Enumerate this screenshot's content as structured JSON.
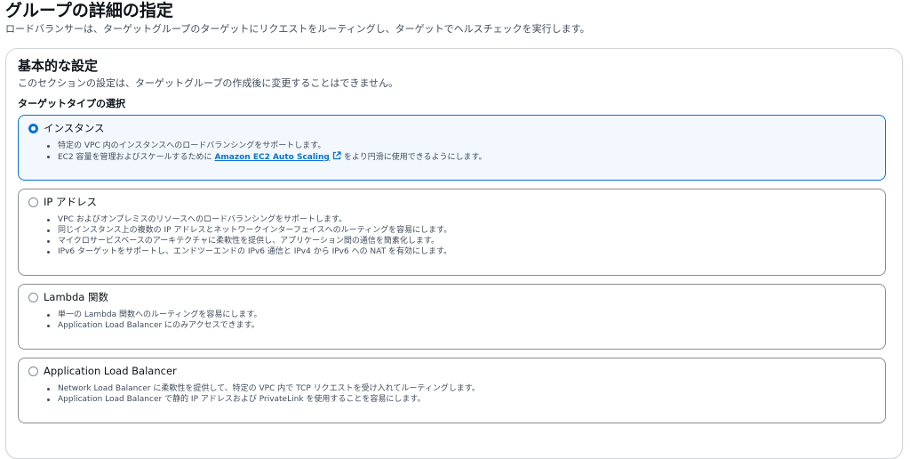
{
  "header": {
    "title": "グループの詳細の指定",
    "description": "ロードバランサーは、ターゲットグループのターゲットにリクエストをルーティングし、ターゲットでヘルスチェックを実行します。"
  },
  "basic_settings": {
    "title": "基本的な設定",
    "description": "このセクションの設定は、ターゲットグループの作成後に変更することはできません。",
    "target_type_label": "ターゲットタイプの選択",
    "selected": "instances",
    "options": {
      "instances": {
        "label": "インスタンス",
        "bullet_1": "特定の VPC 内のインスタンスへのロードバランシングをサポートします。",
        "bullet_2_prefix": "EC2 容量を管理およびスケールするために",
        "bullet_2_link": "Amazon EC2 Auto Scaling",
        "bullet_2_link_icon": "external-link-icon",
        "bullet_2_suffix": "をより円滑に使用できるようにします。"
      },
      "ip": {
        "label": "IP アドレス",
        "bullets": [
          "VPC およびオンプレミスのリソースへのロードバランシングをサポートします。",
          "同じインスタンス上の複数の IP アドレスとネットワークインターフェイスへのルーティングを容易にします。",
          "マイクロサービスベースのアーキテクチャに柔軟性を提供し、アプリケーション間の通信を簡素化します。",
          "IPv6 ターゲットをサポートし、エンドツーエンドの IPv6 通信と IPv4 から IPv6 への NAT を有効にします。"
        ]
      },
      "lambda": {
        "label": "Lambda 関数",
        "bullets": [
          "単一の Lambda 関数へのルーティングを容易にします。",
          "Application Load Balancer にのみアクセスできます。"
        ]
      },
      "alb": {
        "label": "Application Load Balancer",
        "bullets": [
          "Network Load Balancer に柔軟性を提供して、特定の VPC 内で TCP リクエストを受け入れてルーティングします。",
          "Application Load Balancer で静的 IP アドレスおよび PrivateLink を使用することを容易にします。"
        ]
      }
    }
  },
  "colors": {
    "accent": "#0972d3",
    "selected_bg": "#f2f8fd",
    "border": "#8c8c94",
    "text_secondary": "#414d5c"
  }
}
